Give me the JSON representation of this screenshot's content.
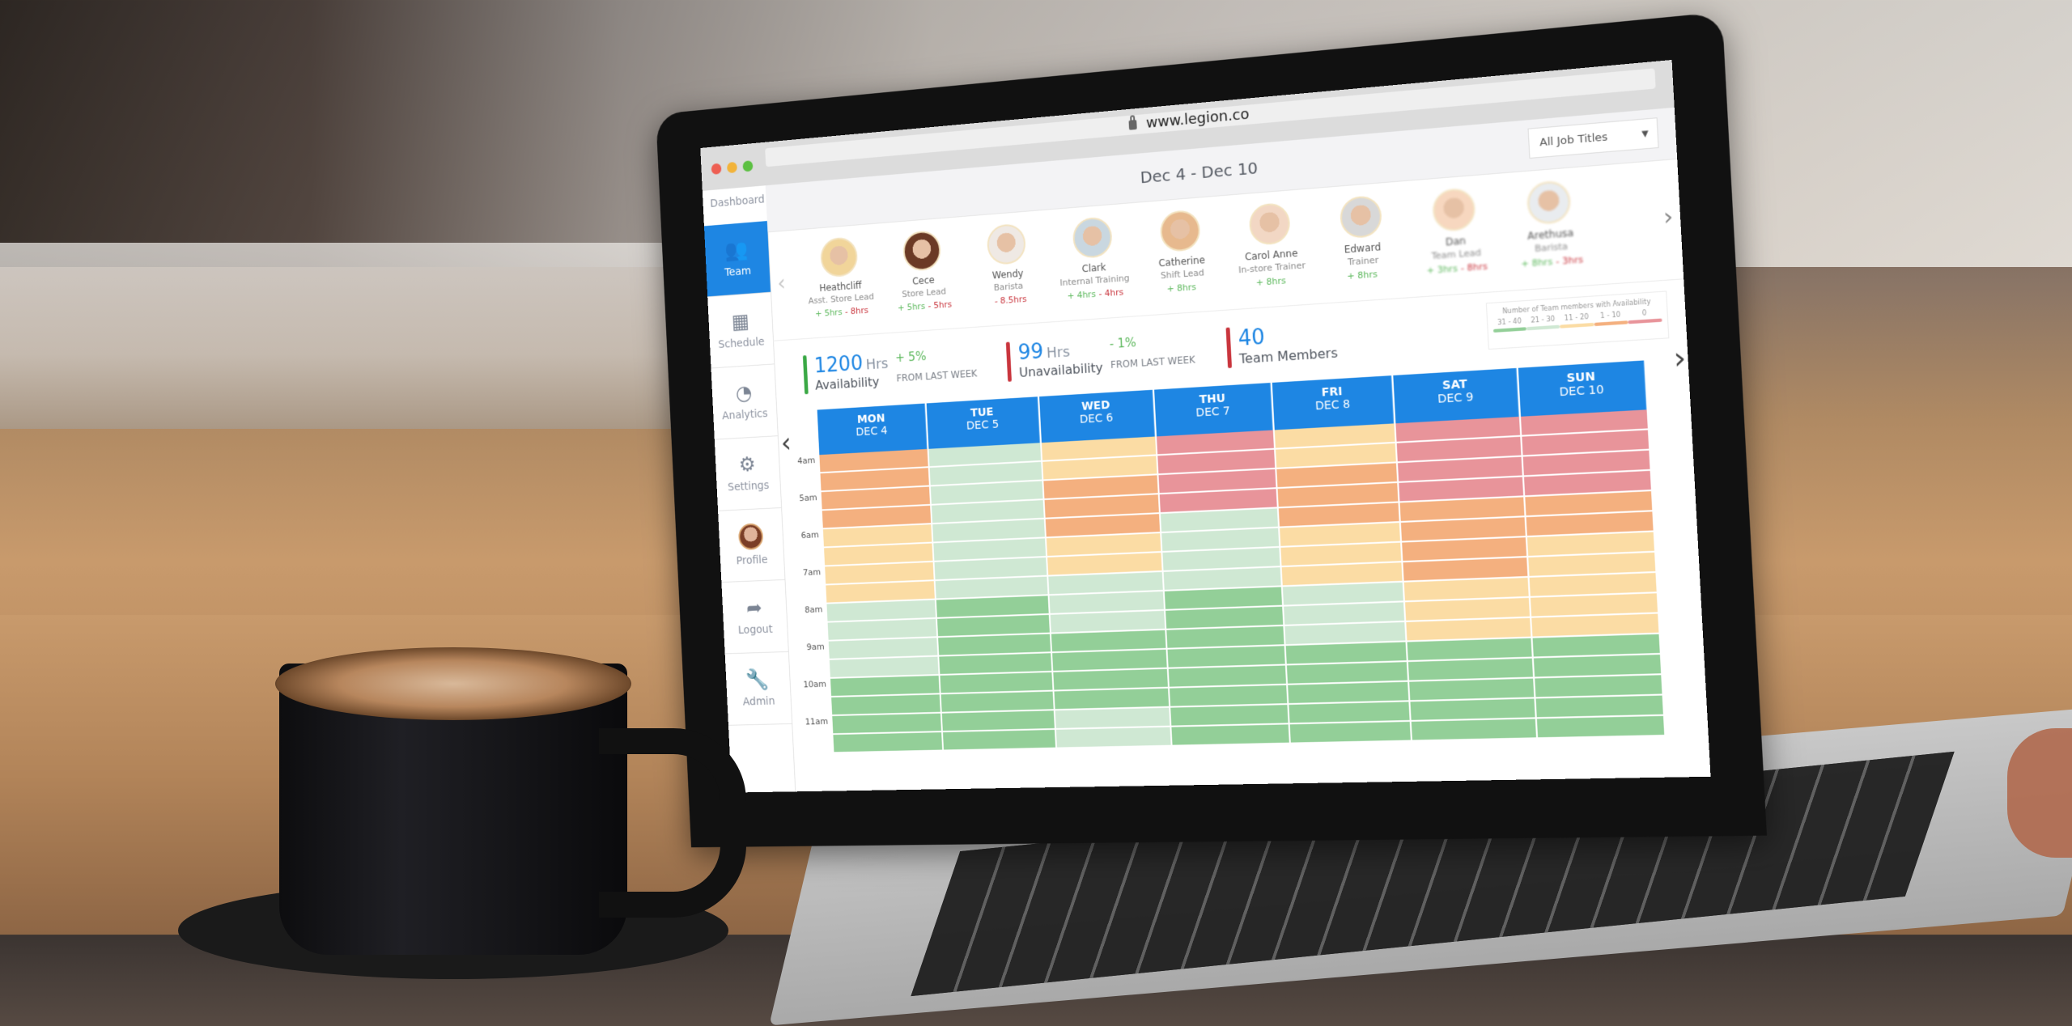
{
  "browser": {
    "url": "www.legion.co",
    "traffic_lights": [
      "#ee5f53",
      "#f2b33a",
      "#5cc042"
    ]
  },
  "sidebar": {
    "dashboard_label": "Dashboard",
    "items": [
      {
        "label": "Team",
        "icon": "team-icon",
        "glyph": "👥",
        "active": true
      },
      {
        "label": "Schedule",
        "icon": "calendar-icon",
        "glyph": "▦",
        "active": false
      },
      {
        "label": "Analytics",
        "icon": "pie-chart-icon",
        "glyph": "◔",
        "active": false
      },
      {
        "label": "Settings",
        "icon": "gear-icon",
        "glyph": "⚙",
        "active": false
      },
      {
        "label": "Profile",
        "icon": "avatar",
        "glyph": "",
        "active": false
      },
      {
        "label": "Logout",
        "icon": "logout-icon",
        "glyph": "➦",
        "active": false
      },
      {
        "label": "Admin",
        "icon": "wrench-icon",
        "glyph": "🔧",
        "active": false
      }
    ]
  },
  "header": {
    "date_range": "Dec 4 - Dec 10",
    "job_filter": "All Job Titles"
  },
  "team": {
    "members": [
      {
        "name": "Heathcliff",
        "role": "Asst. Store Lead",
        "plus": "+ 5hrs",
        "minus": "- 8hrs"
      },
      {
        "name": "Cece",
        "role": "Store Lead",
        "plus": "+ 5hrs",
        "minus": "- 5hrs"
      },
      {
        "name": "Wendy",
        "role": "Barista",
        "plus": "",
        "minus": "- 8.5hrs"
      },
      {
        "name": "Clark",
        "role": "Internal Training",
        "plus": "+ 4hrs",
        "minus": "- 4hrs"
      },
      {
        "name": "Catherine",
        "role": "Shift Lead",
        "plus": "+ 8hrs",
        "minus": ""
      },
      {
        "name": "Carol Anne",
        "role": "In-store Trainer",
        "plus": "+ 8hrs",
        "minus": ""
      },
      {
        "name": "Edward",
        "role": "Trainer",
        "plus": "+ 8hrs",
        "minus": ""
      },
      {
        "name": "Dan",
        "role": "Team Lead",
        "plus": "+ 3hrs",
        "minus": "- 8hrs"
      },
      {
        "name": "Arethusa",
        "role": "Barista",
        "plus": "+ 8hrs",
        "minus": "- 3hrs"
      }
    ]
  },
  "stats": {
    "availability": {
      "value": "1200",
      "unit": "Hrs",
      "label": "Availability",
      "change": "+ 5%",
      "from": "FROM LAST WEEK"
    },
    "unavailability": {
      "value": "99",
      "unit": "Hrs",
      "label": "Unavailability",
      "change": "- 1%",
      "from": "FROM LAST WEEK"
    },
    "members": {
      "value": "40",
      "label": "Team Members"
    }
  },
  "colors": {
    "accent": "#1e86e3",
    "positive": "#5cb85c",
    "negative": "#c9353d"
  },
  "chart_data": {
    "type": "heatmap",
    "title": "Number of Team members with Availability",
    "legend": [
      {
        "label": "31 - 40",
        "level": 4,
        "color": "#93cf98"
      },
      {
        "label": "21 - 30",
        "level": 3,
        "color": "#cfe8d3"
      },
      {
        "label": "11 - 20",
        "level": 2,
        "color": "#fbdca4"
      },
      {
        "label": "1 - 10",
        "level": 1,
        "color": "#f4b07f"
      },
      {
        "label": "0",
        "level": 0,
        "color": "#e8949a"
      }
    ],
    "days": [
      {
        "dow": "MON",
        "date": "DEC 4"
      },
      {
        "dow": "TUE",
        "date": "DEC 5"
      },
      {
        "dow": "WED",
        "date": "DEC 6"
      },
      {
        "dow": "THU",
        "date": "DEC 7"
      },
      {
        "dow": "FRI",
        "date": "DEC 8"
      },
      {
        "dow": "SAT",
        "date": "DEC 9"
      },
      {
        "dow": "SUN",
        "date": "DEC 10"
      }
    ],
    "time_labels": [
      "4am",
      "5am",
      "6am",
      "7am",
      "8am",
      "9am",
      "10am",
      "11am"
    ],
    "slots_per_hour": 2,
    "levels": [
      [
        1,
        1,
        1,
        1,
        2,
        2,
        2,
        2,
        3,
        3,
        3,
        3,
        4,
        4,
        4,
        4
      ],
      [
        3,
        3,
        3,
        3,
        3,
        3,
        3,
        3,
        4,
        4,
        4,
        4,
        4,
        4,
        4,
        4
      ],
      [
        2,
        2,
        1,
        1,
        1,
        2,
        2,
        3,
        3,
        3,
        4,
        4,
        4,
        4,
        3,
        3
      ],
      [
        0,
        0,
        0,
        0,
        3,
        3,
        3,
        3,
        4,
        4,
        4,
        4,
        4,
        4,
        4,
        4
      ],
      [
        2,
        2,
        1,
        1,
        1,
        2,
        2,
        2,
        3,
        3,
        3,
        4,
        4,
        4,
        4,
        4
      ],
      [
        0,
        0,
        0,
        0,
        1,
        1,
        1,
        1,
        2,
        2,
        2,
        4,
        4,
        4,
        4,
        4
      ],
      [
        0,
        0,
        0,
        0,
        1,
        1,
        2,
        2,
        2,
        2,
        2,
        4,
        4,
        4,
        4,
        4
      ]
    ]
  }
}
